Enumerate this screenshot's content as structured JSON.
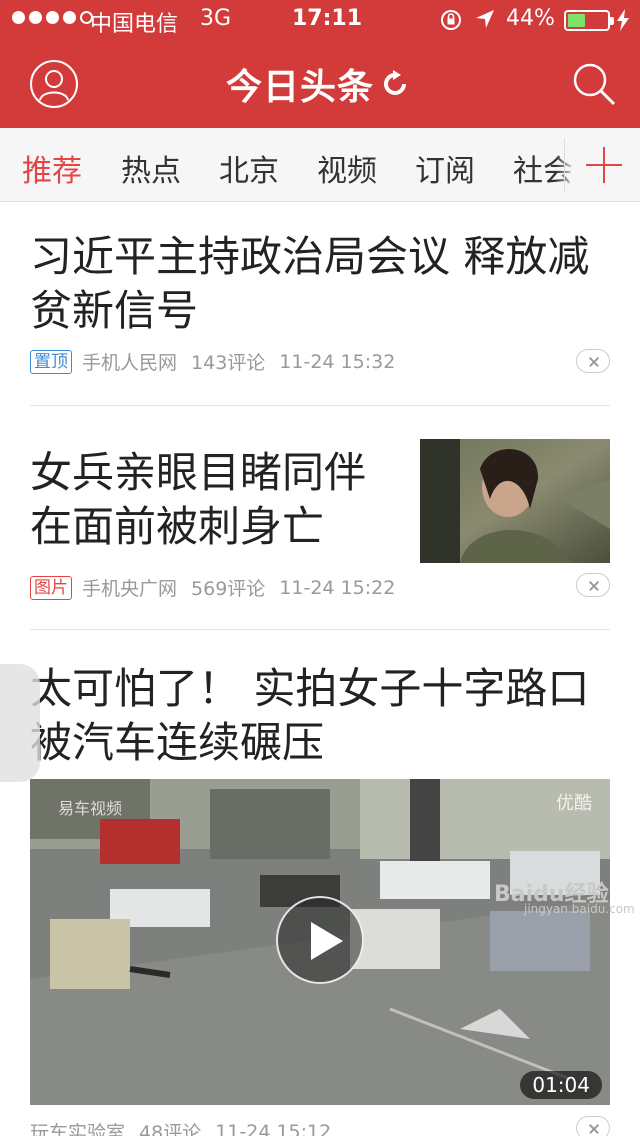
{
  "status_bar": {
    "carrier": "中国电信",
    "network": "3G",
    "time": "17:11",
    "battery": "44%",
    "battery_level": 0.44
  },
  "header": {
    "logo_text": "今日头条",
    "icons": [
      "user-avatar-icon",
      "refresh-icon",
      "search-icon"
    ]
  },
  "tabs": [
    {
      "label": "推荐",
      "active": true
    },
    {
      "label": "热点",
      "active": false
    },
    {
      "label": "北京",
      "active": false
    },
    {
      "label": "视频",
      "active": false
    },
    {
      "label": "订阅",
      "active": false
    },
    {
      "label": "社会",
      "active": false
    }
  ],
  "articles": [
    {
      "title": "习近平主持政治局会议 释放减贫新信号",
      "badge": "置顶",
      "source": "手机人民网",
      "comments": "143评论",
      "time": "11-24 15:32"
    },
    {
      "title": "女兵亲眼目睹同伴在面前被刺身亡",
      "badge": "图片",
      "source": "手机央广网",
      "comments": "569评论",
      "time": "11-24 15:22"
    },
    {
      "title": "太可怕了！ 实拍女子十字路口被汽车连续碾压",
      "duration": "01:04",
      "source": "玩车实验室",
      "comments": "48评论",
      "time": "11-24 15:12",
      "video_watermark_left": "易车视频",
      "video_watermark_right": "优酷"
    }
  ],
  "watermark": {
    "brand": "Baidu经验",
    "url": "jingyan.baidu.com"
  },
  "colors": {
    "brand_red": "#d33a3a",
    "active_tab": "#e64545",
    "badge_blue": "#3b8cde",
    "meta_gray": "#999999"
  }
}
